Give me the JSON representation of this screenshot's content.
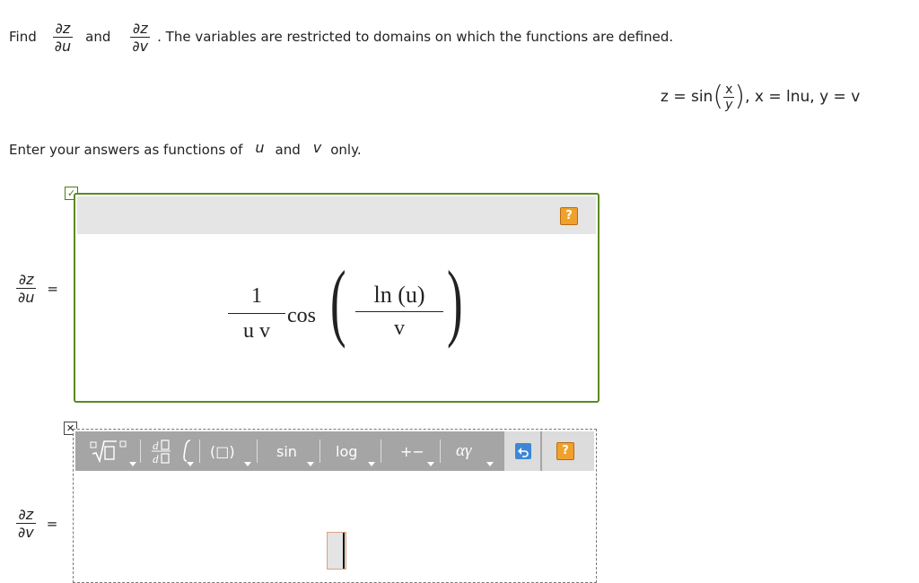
{
  "question": {
    "find_label": "Find",
    "partial_z": "∂z",
    "partial_u": "∂u",
    "partial_v": "∂v",
    "and_label": "and",
    "rest": ". The variables are restricted to domains on which the functions are defined."
  },
  "equation": {
    "lhs": "z = sin",
    "frac_num": "x",
    "frac_den": "y",
    "rest": ", x = lnu, y = v"
  },
  "instruction": {
    "prefix": "Enter your answers as functions of",
    "var_u": "u",
    "and_label": "and",
    "var_v": "v",
    "suffix": "only."
  },
  "answer1": {
    "lhs_num": "∂z",
    "lhs_den": "∂u",
    "equals": "=",
    "coef_num": "1",
    "coef_den": "u v",
    "func": "cos",
    "inner_num": "ln (u)",
    "inner_den": "v",
    "status_icon": "check-icon"
  },
  "answer2": {
    "lhs_num": "∂z",
    "lhs_den": "∂v",
    "equals": "=",
    "status_icon": "x-icon"
  },
  "toolbar": {
    "paren_label": "(□)",
    "sin_label": "sin",
    "log_label": "log",
    "plusminus_label": "+−",
    "greek_label": "αγ",
    "help_label": "?"
  },
  "help_label": "?",
  "colors": {
    "correct_border": "#5a8a1e",
    "toolbar_bg": "#a5a5a5",
    "undo_bg": "#3d87d6",
    "help_bg": "#f0a12b"
  }
}
